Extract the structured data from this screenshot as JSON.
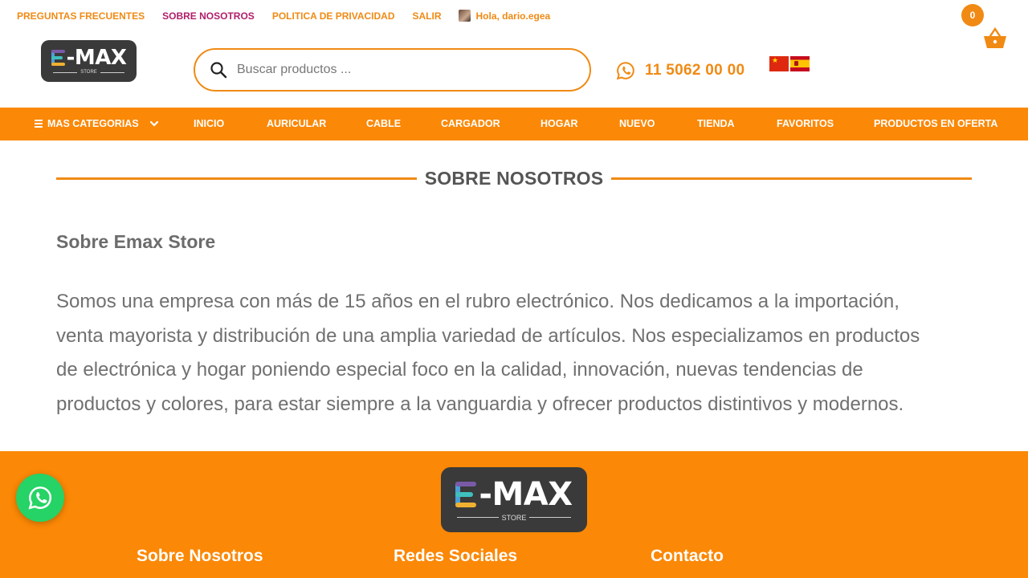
{
  "topnav": {
    "faq": "PREGUNTAS FRECUENTES",
    "about": "SOBRE NOSOTROS",
    "privacy": "POLITICA DE PRIVACIDAD",
    "logout": "SALIR",
    "greeting": "Hola, dario.egea"
  },
  "header": {
    "logo_text": "-MAX",
    "logo_sub": "STORE",
    "search_placeholder": "Buscar productos ...",
    "phone": "11 5062 00 00",
    "cart_count": "0",
    "flags": [
      "china-flag-icon",
      "spain-flag-icon"
    ]
  },
  "mainnav": {
    "categories": "MAS CATEGORIAS",
    "items": [
      "INICIO",
      "AURICULAR",
      "CABLE",
      "CARGADOR",
      "HOGAR",
      "NUEVO",
      "TIENDA",
      "FAVORITOS",
      "PRODUCTOS EN OFERTA"
    ]
  },
  "content": {
    "section_title": "SOBRE NOSOTROS",
    "about_title": "Sobre Emax Store",
    "about_lines": [
      "Somos una empresa con más de 15 años en el rubro electrónico. Nos dedicamos a la importación,",
      "venta mayorista y distribución de una amplia variedad de artículos. Nos especializamos en productos",
      "de electrónica y hogar poniendo especial foco en la calidad, innovación, nuevas tendencias de",
      "productos y colores, para estar siempre a la vanguardia y ofrecer productos distintivos y modernos."
    ]
  },
  "footer": {
    "logo_text": "-MAX",
    "logo_sub": "STORE",
    "col_about": "Sobre Nosotros",
    "col_social": "Redes Sociales",
    "col_contact": "Contacto"
  },
  "colors": {
    "accent": "#fb8806",
    "active_link": "#b11e6a",
    "whatsapp": "#25d366"
  }
}
